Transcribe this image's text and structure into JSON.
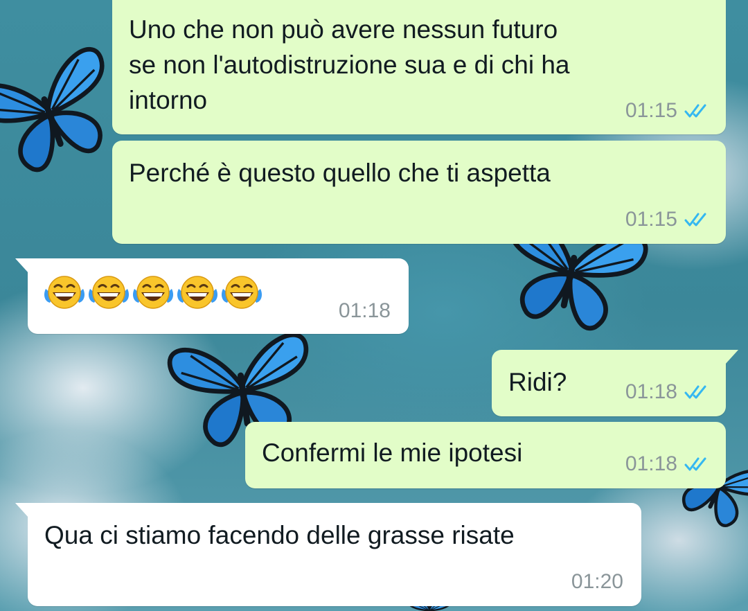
{
  "chat": {
    "messages": [
      {
        "direction": "outgoing",
        "text": "Uno che non può avere nessun futuro\nse non l'autodistruzione sua e di chi ha\nintorno",
        "time": "01:15",
        "status": "read"
      },
      {
        "direction": "outgoing",
        "text": "Perché è questo quello che ti aspetta",
        "time": "01:15",
        "status": "read"
      },
      {
        "direction": "incoming",
        "emoji": [
          "face-with-tears-of-joy",
          "face-with-tears-of-joy",
          "face-with-tears-of-joy",
          "face-with-tears-of-joy",
          "face-with-tears-of-joy"
        ],
        "time": "01:18"
      },
      {
        "direction": "outgoing",
        "text": "Ridi?",
        "time": "01:18",
        "status": "read"
      },
      {
        "direction": "outgoing",
        "text": "Confermi le mie ipotesi",
        "time": "01:18",
        "status": "read"
      },
      {
        "direction": "incoming",
        "text": "Qua ci stiamo facendo delle grasse risate",
        "time": "01:20"
      }
    ]
  },
  "colors": {
    "outgoing_bubble": "#e2fdc8",
    "incoming_bubble": "#ffffff",
    "read_ticks": "#34b7f1",
    "timestamp": "#8a9599",
    "wallpaper": "#3f8a9c"
  },
  "wallpaper": {
    "motif": "blue butterflies on glitter"
  }
}
